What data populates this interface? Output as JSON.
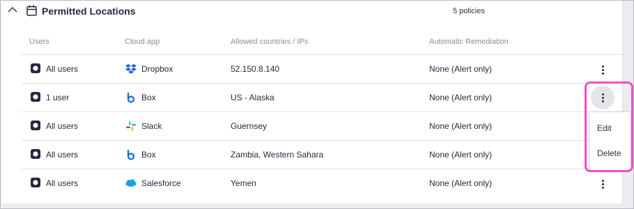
{
  "section": {
    "title": "Permitted Locations",
    "policy_count": "5 policies"
  },
  "columns": [
    "Users",
    "Cloud app",
    "Allowed countries / IPs",
    "Automatic Remediation"
  ],
  "rows": [
    {
      "users": "All users",
      "app": "Dropbox",
      "app_icon": "dropbox-icon",
      "locations": "52.150.8.140",
      "remediation": "None (Alert only)"
    },
    {
      "users": "1 user",
      "app": "Box",
      "app_icon": "box-icon",
      "locations": "US - Alaska",
      "remediation": "None (Alert only)"
    },
    {
      "users": "All users",
      "app": "Slack",
      "app_icon": "slack-icon",
      "locations": "Guernsey",
      "remediation": "None (Alert only)"
    },
    {
      "users": "All users",
      "app": "Box",
      "app_icon": "box-icon",
      "locations": "Zambia, Western Sahara",
      "remediation": "None (Alert only)"
    },
    {
      "users": "All users",
      "app": "Salesforce",
      "app_icon": "salesforce-icon",
      "locations": "Yemen",
      "remediation": "None (Alert only)"
    }
  ],
  "context_menu": {
    "edit_label": "Edit",
    "delete_label": "Delete"
  },
  "colors": {
    "highlight": "#f04fc3",
    "box_blue": "#0a6fd6",
    "dropbox_blue": "#1b5fd8",
    "salesforce_blue": "#19a3de",
    "title_text": "#27273f"
  }
}
